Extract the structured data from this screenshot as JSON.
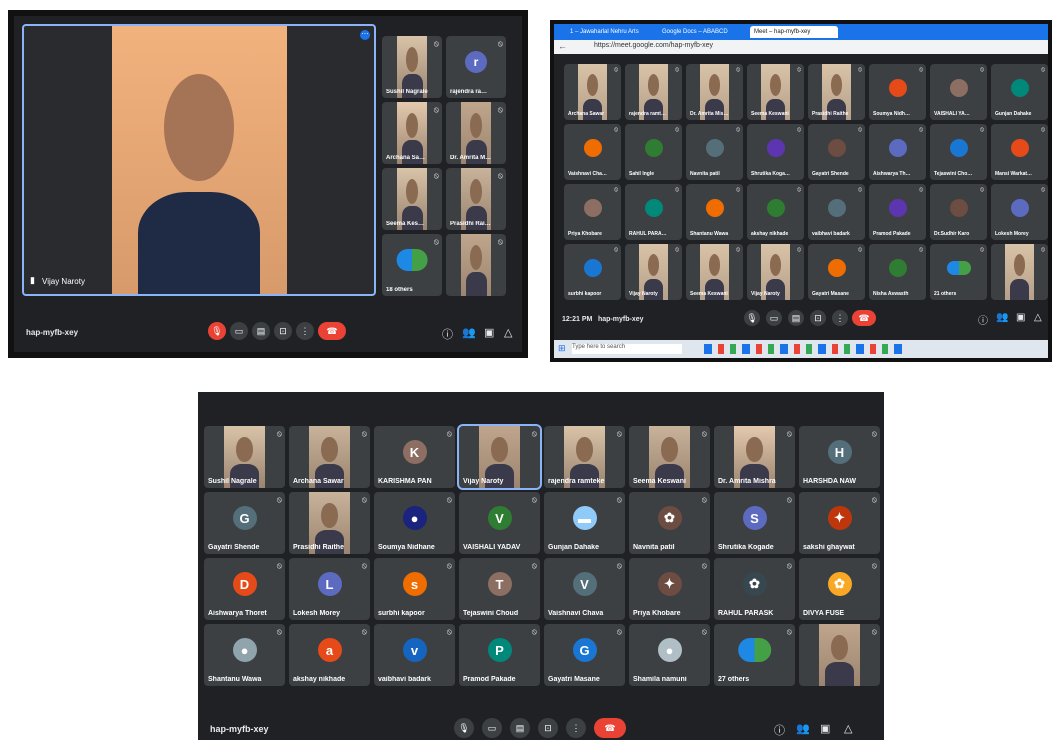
{
  "panel1": {
    "speaker_name": "Vijay Naroty",
    "meeting_code": "hap-myfb-xey",
    "others_label": "18 others",
    "side_tiles": [
      {
        "name": "Sushil Nagrale",
        "type": "video"
      },
      {
        "name": "rajendra ramteke",
        "type": "avatar",
        "initial": "r",
        "color": "#5c6bc0"
      },
      {
        "name": "Archana Sawarkar",
        "type": "video"
      },
      {
        "name": "Dr. Amrita Mishra",
        "type": "video"
      },
      {
        "name": "Seema Keswani",
        "type": "video"
      },
      {
        "name": "Prasidhi Raithe",
        "type": "video"
      },
      {
        "name": "18 others",
        "type": "others"
      },
      {
        "name": "",
        "type": "video"
      }
    ]
  },
  "panel2": {
    "tabs": [
      "1 – Jawaharlal Nehru Arts",
      "Google Docs – ABABCD",
      "Meet – hap-myfb-xey"
    ],
    "url": "https://meet.google.com/hap-myfb-xey",
    "time": "12:21 PM",
    "meeting_code": "hap-myfb-xey",
    "search_placeholder": "Type here to search",
    "others_label": "21 others",
    "tiles": [
      "Archana Sawar",
      "rajendra ramteke",
      "Dr. Amrita Mishra",
      "Seema Keswani",
      "Prasidhi Raithe",
      "Soumya Nidhane",
      "VAISHALI YADAV",
      "Gunjan Dahake",
      "Vaishnavi Chava",
      "Sahil Ingle",
      "Navnita patil",
      "Shrutika Kogade",
      "Gayatri Shende",
      "Aishwarya Thoret",
      "Tejaswini Choud",
      "Mansi Warkatkar",
      "Priya Khobare",
      "RAHUL PARASK",
      "Shantanu Wawa",
      "akshay nikhade",
      "vaibhavi badark",
      "Pramod Pakade",
      "Dr.Sudhir Karo",
      "Lokesh Morey",
      "surbhi kapoor",
      "Vijay Naroty",
      "Seema Keswani",
      "Vijay Naroty",
      "Gayatri Masane",
      "Nisha Aswasth",
      "21 others",
      ""
    ]
  },
  "panel3": {
    "meeting_code": "hap-myfb-xey",
    "tiles": [
      {
        "name": "Sushil Nagrale",
        "type": "video"
      },
      {
        "name": "Archana Sawar",
        "type": "video"
      },
      {
        "name": "KARISHMA PAN",
        "type": "avatar",
        "initial": "K",
        "color": "#8d6e63"
      },
      {
        "name": "Vijay Naroty",
        "type": "video"
      },
      {
        "name": "rajendra ramteke",
        "type": "video"
      },
      {
        "name": "Seema Keswani",
        "type": "video"
      },
      {
        "name": "Dr. Amrita Mishra",
        "type": "video"
      },
      {
        "name": "HARSHDA NAW",
        "type": "avatar",
        "initial": "H",
        "color": "#546e7a"
      },
      {
        "name": "Gayatri Shende",
        "type": "avatar",
        "initial": "G",
        "color": "#546e7a"
      },
      {
        "name": "Prasidhi Raithe",
        "type": "video"
      },
      {
        "name": "Soumya Nidhane",
        "type": "avatar",
        "initial": "●",
        "color": "#1a237e"
      },
      {
        "name": "VAISHALI YADAV",
        "type": "avatar",
        "initial": "V",
        "color": "#2e7d32"
      },
      {
        "name": "Gunjan Dahake",
        "type": "avatar",
        "initial": "▬",
        "color": "#90caf9"
      },
      {
        "name": "Navnita patil",
        "type": "avatar",
        "initial": "✿",
        "color": "#6d4c41"
      },
      {
        "name": "Shrutika Kogade",
        "type": "avatar",
        "initial": "S",
        "color": "#5c6bc0"
      },
      {
        "name": "sakshi ghaywat",
        "type": "avatar",
        "initial": "✦",
        "color": "#bf360c"
      },
      {
        "name": "Aishwarya Thoret",
        "type": "avatar",
        "initial": "D",
        "color": "#e64a19"
      },
      {
        "name": "Lokesh Morey",
        "type": "avatar",
        "initial": "L",
        "color": "#5c6bc0"
      },
      {
        "name": "surbhi kapoor",
        "type": "avatar",
        "initial": "s",
        "color": "#ef6c00"
      },
      {
        "name": "Tejaswini Choud",
        "type": "avatar",
        "initial": "T",
        "color": "#8d6e63"
      },
      {
        "name": "Vaishnavi Chava",
        "type": "avatar",
        "initial": "V",
        "color": "#546e7a"
      },
      {
        "name": "Priya Khobare",
        "type": "avatar",
        "initial": "✦",
        "color": "#6d4c41"
      },
      {
        "name": "RAHUL PARASK",
        "type": "avatar",
        "initial": "✿",
        "color": "#37474f"
      },
      {
        "name": "DIVYA FUSE",
        "type": "avatar",
        "initial": "✿",
        "color": "#f9a825"
      },
      {
        "name": "Shantanu Wawa",
        "type": "avatar",
        "initial": "●",
        "color": "#90a4ae"
      },
      {
        "name": "akshay nikhade",
        "type": "avatar",
        "initial": "a",
        "color": "#e64a19"
      },
      {
        "name": "vaibhavi badark",
        "type": "avatar",
        "initial": "v",
        "color": "#1565c0"
      },
      {
        "name": "Pramod Pakade",
        "type": "avatar",
        "initial": "P",
        "color": "#00897b"
      },
      {
        "name": "Gayatri Masane",
        "type": "avatar",
        "initial": "G",
        "color": "#1976d2"
      },
      {
        "name": "Shamila namuni",
        "type": "avatar",
        "initial": "●",
        "color": "#b0bec5"
      },
      {
        "name": "27 others",
        "type": "others"
      },
      {
        "name": "",
        "type": "video"
      }
    ]
  },
  "colors": {
    "meet_bg": "#202124",
    "tile_bg": "#3c4043",
    "end_red": "#ea4335"
  }
}
